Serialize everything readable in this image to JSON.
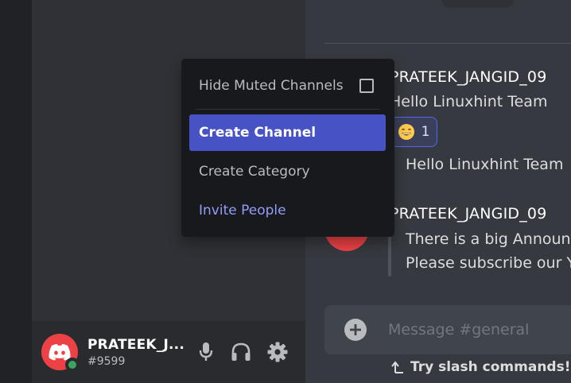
{
  "user_panel": {
    "username": "PRATEEK_J...",
    "tag": "#9599",
    "status": "online",
    "icons": [
      "discord-logo-icon",
      "microphone-icon",
      "headphones-icon",
      "gear-icon"
    ]
  },
  "context_menu": {
    "items": [
      {
        "label": "Hide Muted Channels",
        "type": "checkbox",
        "checked": false
      },
      {
        "label": "Create Channel",
        "highlighted": true
      },
      {
        "label": "Create Category"
      },
      {
        "label": "Invite People",
        "accent": true
      }
    ]
  },
  "chat": {
    "messages": [
      {
        "author": "PRATEEK_JANGID_09",
        "lines": [
          "Hello Linuxhint Team"
        ],
        "reaction": {
          "emoji": "😄",
          "count": "1"
        },
        "followup": "Hello Linuxhint Team"
      },
      {
        "author": "PRATEEK_JANGID_09",
        "lines": [
          "There is a big Announ",
          "Please subscribe our Y"
        ]
      }
    ],
    "composer": {
      "placeholder": "Message #general"
    },
    "slash_hint": "Try slash commands! A"
  },
  "colors": {
    "accent": "#4752c4",
    "brand_red": "#ed4245",
    "online": "#3ba55c",
    "invite_link": "#949cf7"
  }
}
